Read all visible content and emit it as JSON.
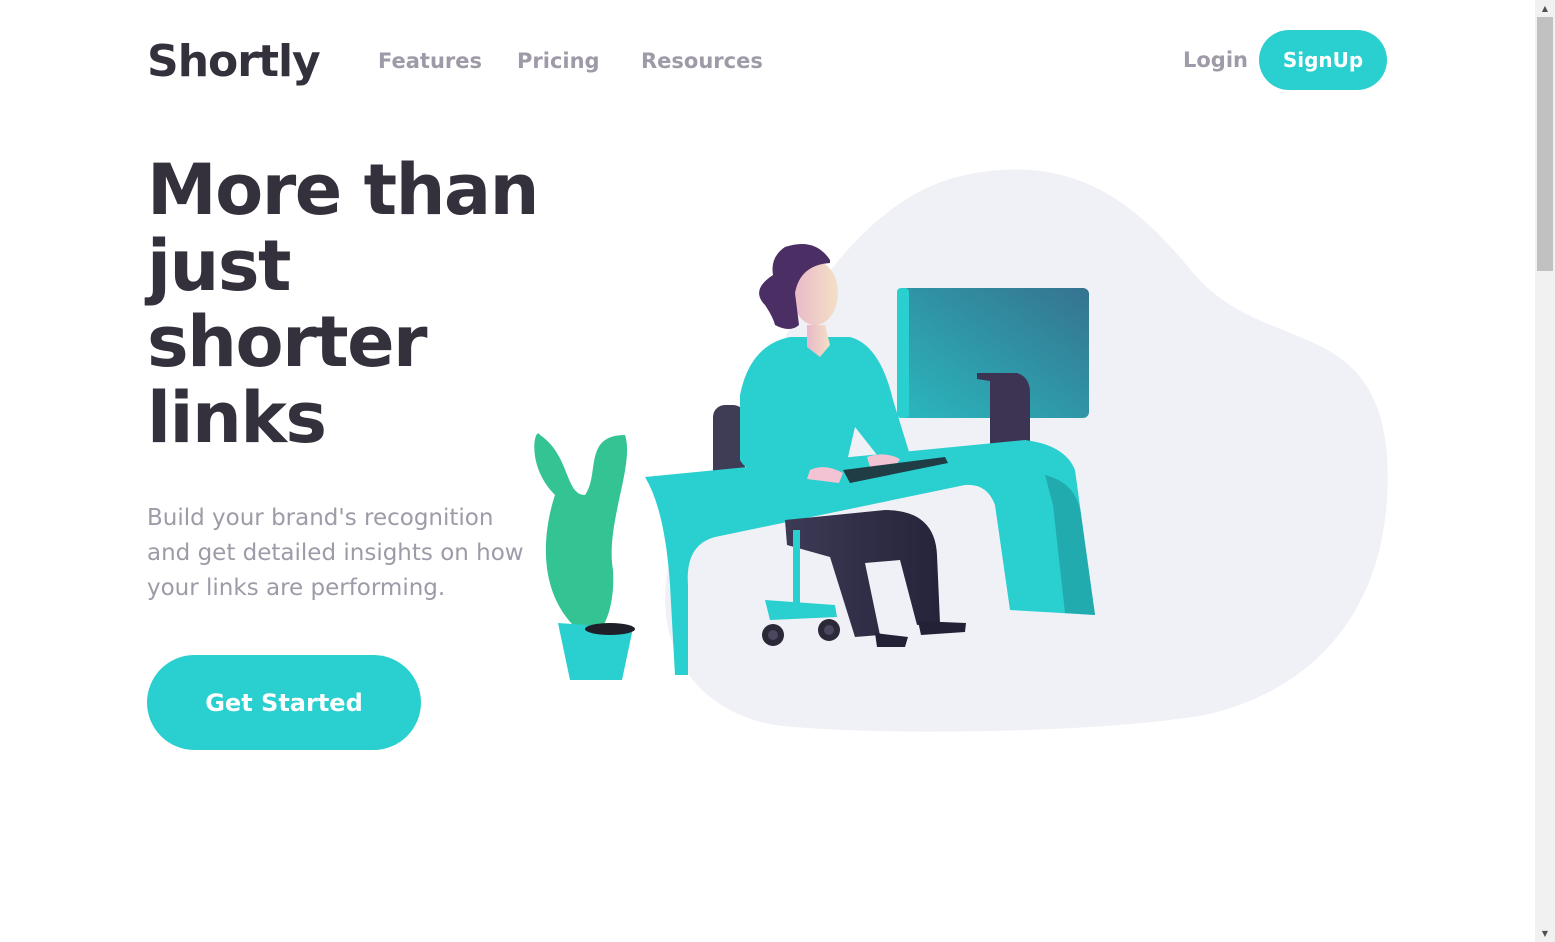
{
  "nav": {
    "logo": "Shortly",
    "links": [
      "Features",
      "Pricing",
      "Resources"
    ],
    "login": "Login",
    "signup": "SignUp"
  },
  "hero": {
    "title": "More than just shorter links",
    "subtitle": "Build your brand's recognition and get detailed insights on how your links are performing.",
    "cta": "Get Started",
    "illustration": "person-working-at-desk-illustration"
  },
  "colors": {
    "accent": "#2acfcf",
    "dark_violet": "#3b3054",
    "heading": "#34313d",
    "gray_text": "#9e9aa7",
    "blob": "#f0f1f6"
  },
  "scrollbar": {
    "up_icon": "scroll-up-arrow-icon",
    "down_icon": "scroll-down-arrow-icon"
  }
}
